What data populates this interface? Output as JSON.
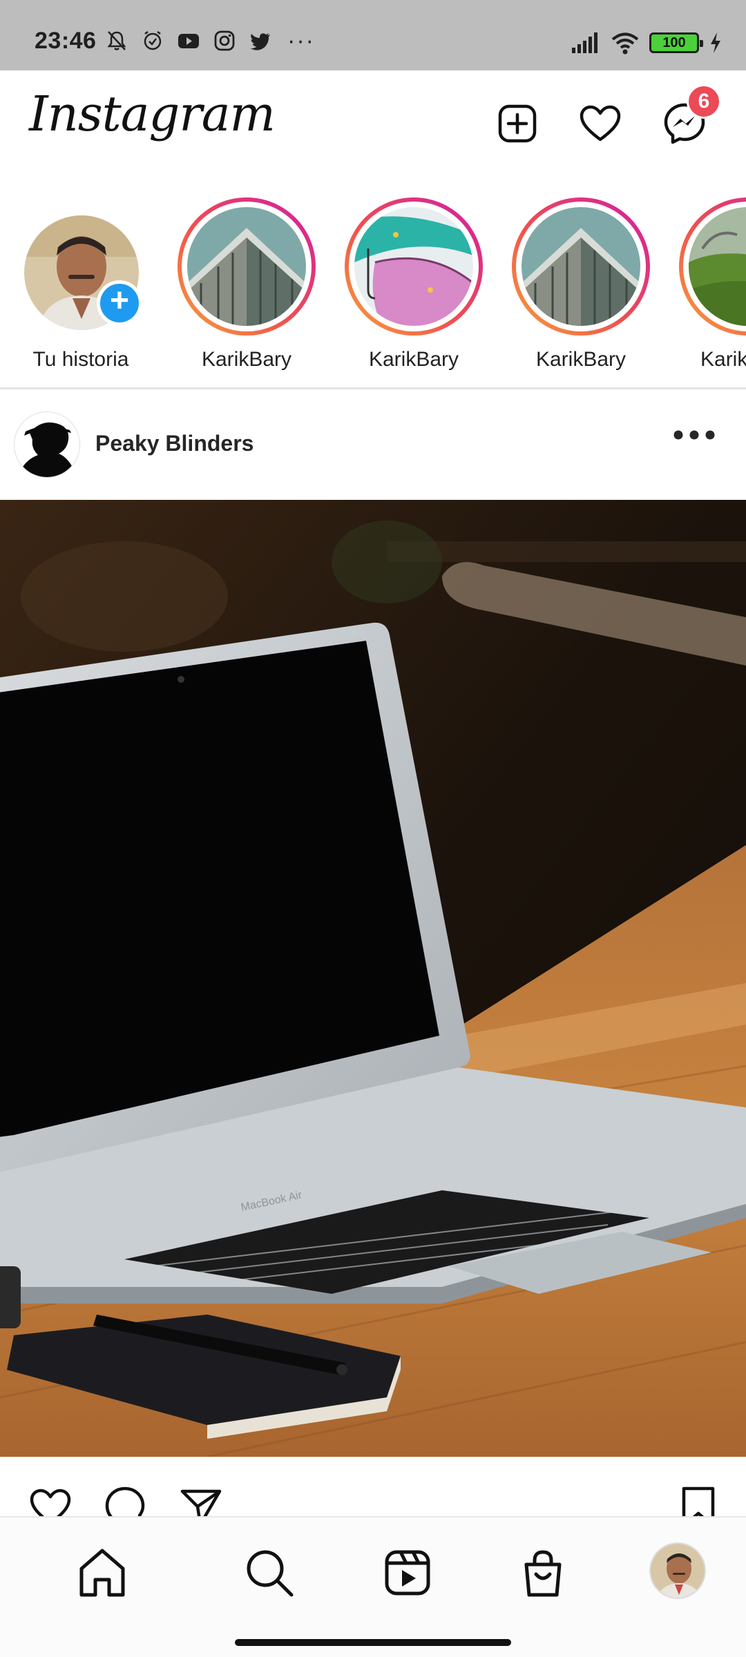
{
  "status_bar": {
    "time": "23:46",
    "left_icons": [
      "bell-off-icon",
      "alarm-icon",
      "youtube-icon",
      "instagram-icon",
      "twitter-icon"
    ],
    "more": "···",
    "battery": "100",
    "right_icons": [
      "signal-icon",
      "wifi-icon",
      "battery-icon",
      "charging-icon"
    ]
  },
  "header": {
    "logo": "Instagram",
    "actions": [
      "new-post-icon",
      "activity-heart-icon",
      "messenger-icon"
    ],
    "messages_badge": "6"
  },
  "stories": {
    "own": {
      "label": "Tu historia",
      "add_icon": "+"
    },
    "items": [
      {
        "label": "KarikBary",
        "thumb": "building"
      },
      {
        "label": "KarikBary",
        "thumb": "umbrella"
      },
      {
        "label": "KarikBary",
        "thumb": "building"
      },
      {
        "label": "Karik",
        "thumb": "hill"
      }
    ]
  },
  "post": {
    "username": "Peaky Blinders",
    "image_alt": "Laptop on wooden table",
    "laptop_brand": "MacBook Air",
    "actions": [
      "like-icon",
      "comment-icon",
      "share-icon",
      "save-icon"
    ]
  },
  "bottom_nav": {
    "items": [
      "home-icon",
      "search-icon",
      "reels-icon",
      "shop-icon",
      "profile-avatar"
    ]
  },
  "colors": {
    "status_bar_bg": "#bdbdbd",
    "badge_red": "#ed4956",
    "add_blue": "#1e9bf0",
    "ring_start": "#f9a23a",
    "ring_end": "#d11ba9"
  }
}
